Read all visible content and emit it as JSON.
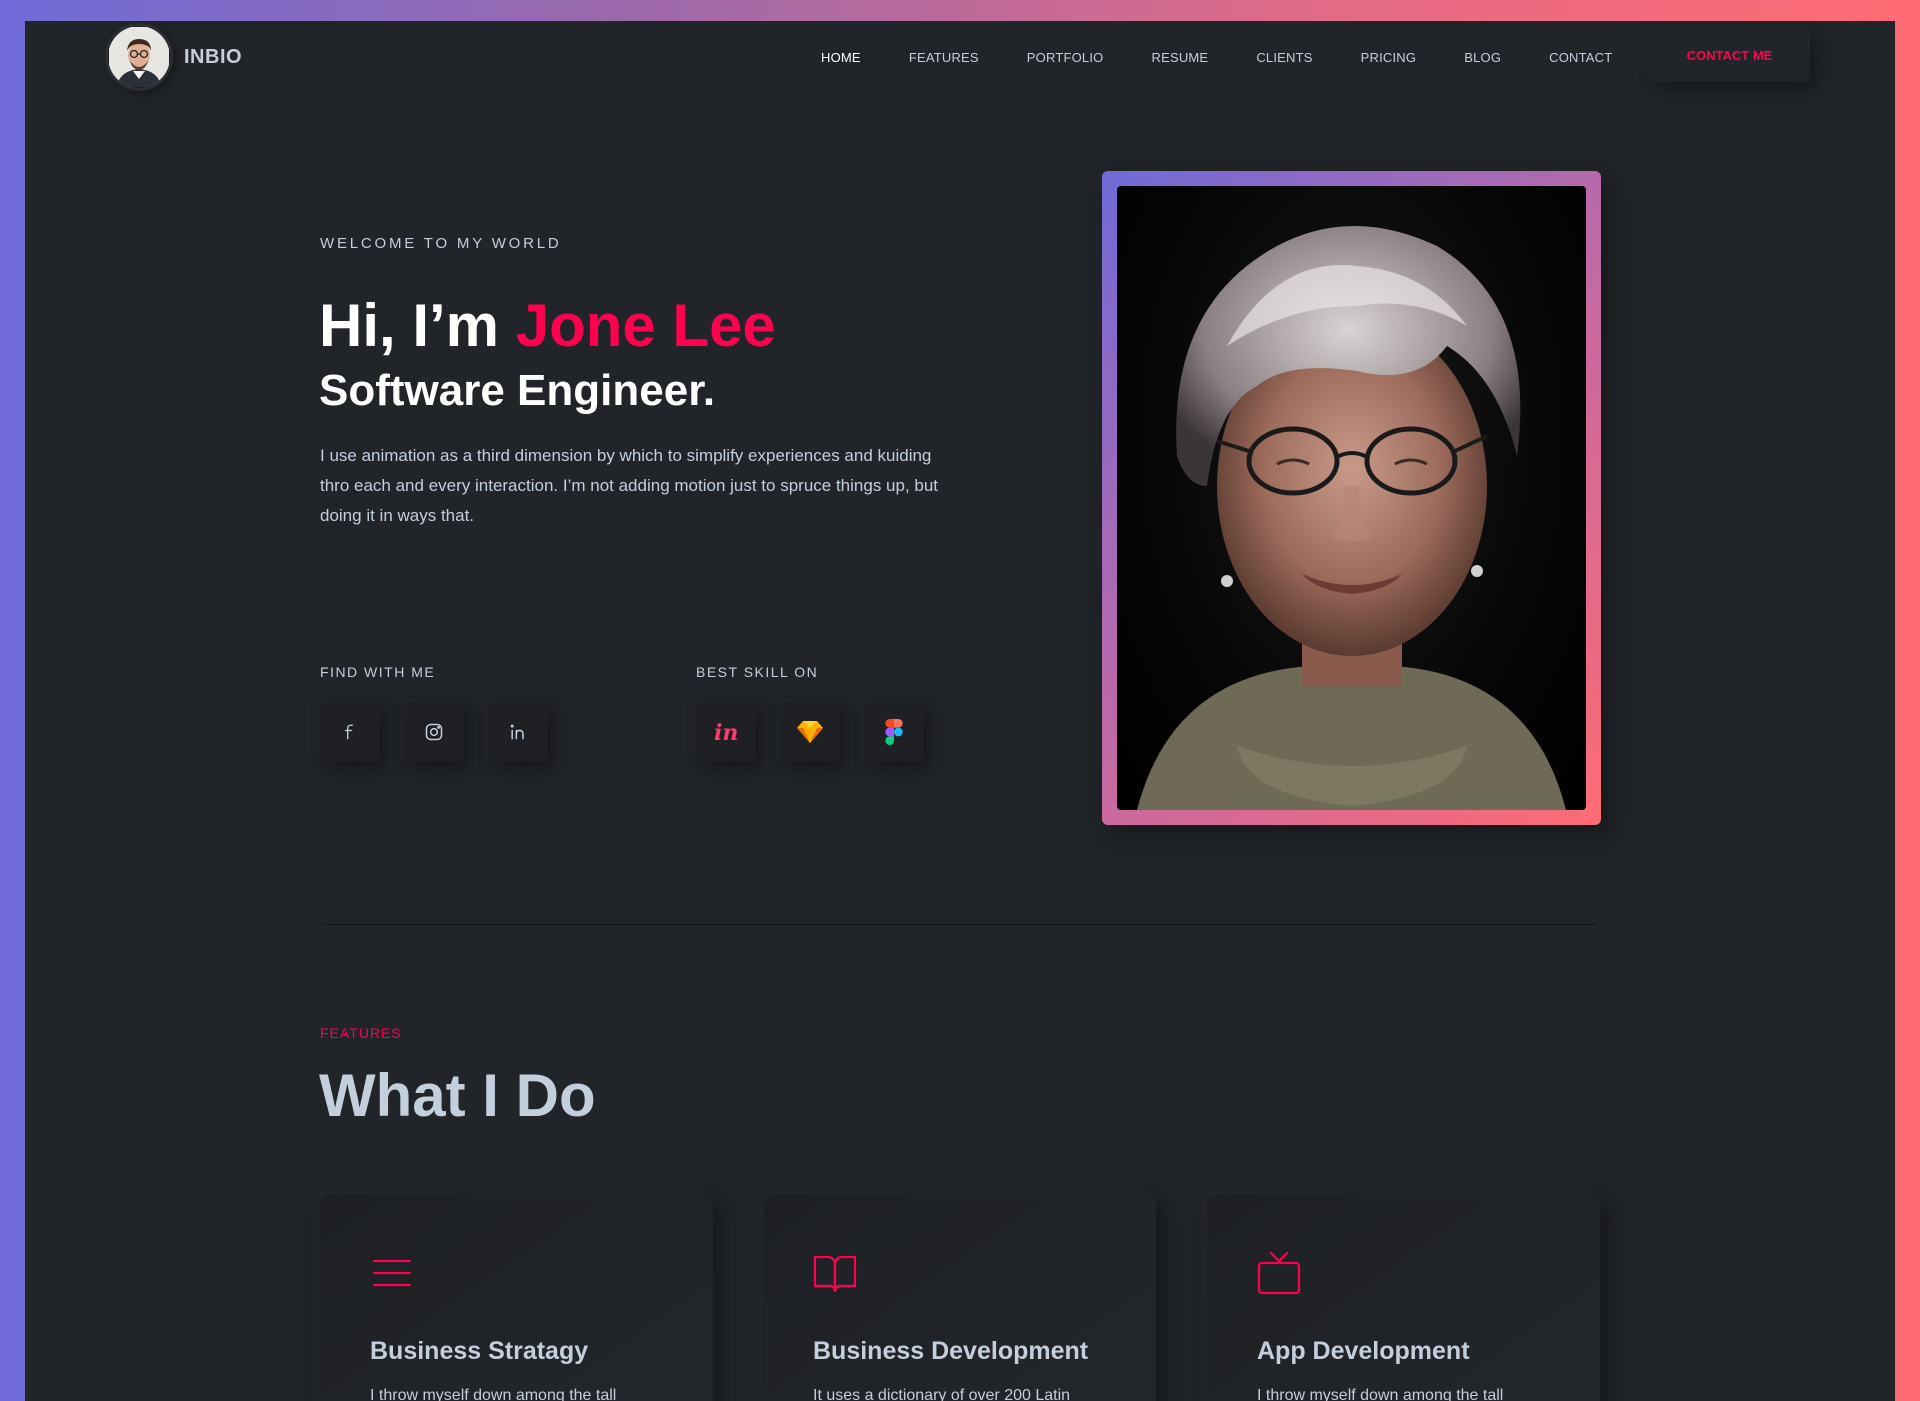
{
  "colors": {
    "accent": "#ff014f",
    "background": "#212428",
    "text": "#c4cfde",
    "gradient_start": "#6f6bd8",
    "gradient_end": "#ff6b73"
  },
  "brand": {
    "name": "INBIO",
    "avatar_icon": "person-avatar-icon"
  },
  "nav": {
    "items": [
      {
        "label": "HOME",
        "active": true
      },
      {
        "label": "FEATURES",
        "active": false
      },
      {
        "label": "PORTFOLIO",
        "active": false
      },
      {
        "label": "RESUME",
        "active": false
      },
      {
        "label": "CLIENTS",
        "active": false
      },
      {
        "label": "PRICING",
        "active": false
      },
      {
        "label": "BLOG",
        "active": false
      },
      {
        "label": "CONTACT",
        "active": false
      }
    ],
    "cta_label": "CONTACT ME"
  },
  "hero": {
    "welcome": "WELCOME TO MY WORLD",
    "greeting": "Hi, I’m ",
    "name": "Jone Lee",
    "role": "Software Engineer.",
    "description": "I use animation as a third dimension by which to simplify experiences and kuiding thro each and every interaction. I’m not adding motion just to spruce things up, but doing it in ways that.",
    "find_label": "FIND WITH ME",
    "skill_label": "BEST SKILL ON",
    "social_icons": [
      "facebook-icon",
      "instagram-icon",
      "linkedin-icon"
    ],
    "skill_icons": [
      "invision-icon",
      "sketch-icon",
      "figma-icon"
    ],
    "portrait_icon": "portrait-photo"
  },
  "features": {
    "label": "FEATURES",
    "title": "What I Do",
    "cards": [
      {
        "icon": "menu-lines-icon",
        "title": "Business Stratagy",
        "text": "I throw myself down among the tall"
      },
      {
        "icon": "open-book-icon",
        "title": "Business Development",
        "text": "It uses a dictionary of over 200 Latin"
      },
      {
        "icon": "tv-icon",
        "title": "App Development",
        "text": "I throw myself down among the tall"
      }
    ]
  }
}
